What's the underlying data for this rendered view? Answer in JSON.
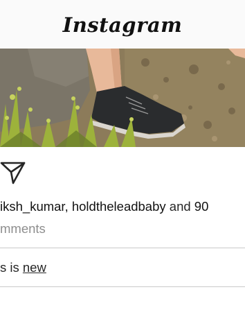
{
  "header": {
    "logo_text": "Instagram"
  },
  "post": {
    "photo_alt": "",
    "likes": {
      "users_text": "iksh_kumar, holdtheleadbaby",
      "and_text": " and ",
      "count_text": "90"
    },
    "comments_text": "mments",
    "message": {
      "prefix": "s is ",
      "link": "new"
    }
  },
  "icons": {
    "send": "send-paper-plane-icon"
  },
  "colors": {
    "header_bg": "#fafafa",
    "text": "#262626",
    "muted": "#8e8e8e",
    "divider": "#c9c9c9"
  }
}
